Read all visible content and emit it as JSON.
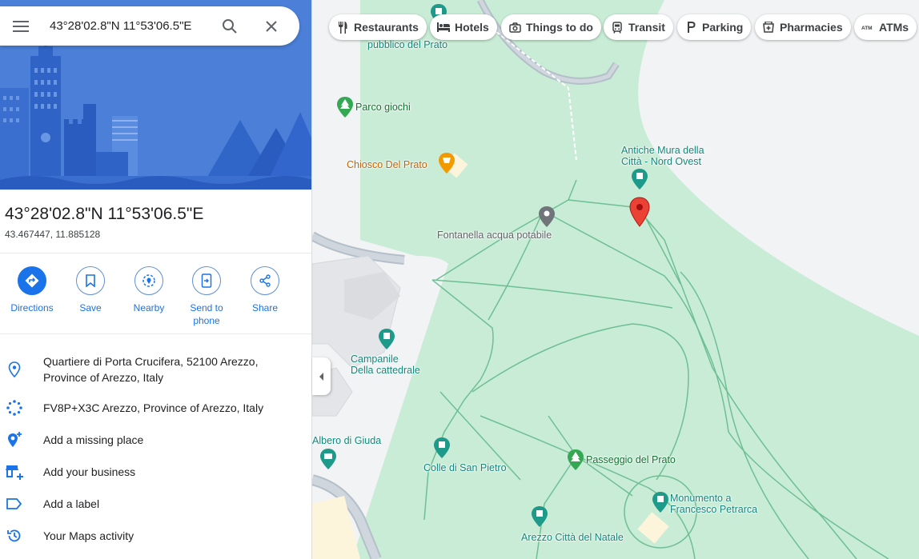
{
  "search": {
    "value": "43°28'02.8\"N 11°53'06.5\"E"
  },
  "place": {
    "title": "43°28'02.8\"N 11°53'06.5\"E",
    "decimal": "43.467447, 11.885128"
  },
  "actions": [
    {
      "label": "Directions",
      "icon": "directions-icon"
    },
    {
      "label": "Save",
      "icon": "bookmark-icon"
    },
    {
      "label": "Nearby",
      "icon": "nearby-icon"
    },
    {
      "label": "Send to phone",
      "icon": "send-to-phone-icon"
    },
    {
      "label": "Share",
      "icon": "share-icon"
    }
  ],
  "info": [
    {
      "text": "Quartiere di Porta Crucifera, 52100 Arezzo, Province of Arezzo, Italy",
      "icon": "location-pin-icon"
    },
    {
      "text": "FV8P+X3C Arezzo, Province of Arezzo, Italy",
      "icon": "plus-code-icon"
    },
    {
      "text": "Add a missing place",
      "icon": "add-location-icon"
    },
    {
      "text": "Add your business",
      "icon": "add-business-icon"
    },
    {
      "text": "Add a label",
      "icon": "label-icon"
    },
    {
      "text": "Your Maps activity",
      "icon": "history-icon"
    }
  ],
  "chips": [
    {
      "label": "Restaurants",
      "icon": "restaurant-icon"
    },
    {
      "label": "Hotels",
      "icon": "hotel-icon"
    },
    {
      "label": "Things to do",
      "icon": "camera-icon"
    },
    {
      "label": "Transit",
      "icon": "transit-icon"
    },
    {
      "label": "Parking",
      "icon": "parking-icon"
    },
    {
      "label": "Pharmacies",
      "icon": "pharmacy-icon"
    },
    {
      "label": "ATMs",
      "icon": "atm-icon"
    }
  ],
  "map_labels": {
    "parco_pubblico": "pubblico del Prato",
    "parco_giochi": "Parco giochi",
    "chiosco": "Chiosco Del Prato",
    "antiche_mura": "Antiche Mura della\nCittà - Nord Ovest",
    "fontanella": "Fontanella acqua potabile",
    "campanile": "Campanile\nDella cattedrale",
    "albero": "Albero di Giuda",
    "colle": "Colle di San Pietro",
    "passeggio": "Passeggio del Prato",
    "monumento": "Monumento a\nFrancesco Petrarca",
    "arezzo_natale": "Arezzo Città del Natale"
  },
  "colors": {
    "park": "#c8ecd5",
    "park_path": "#5fb88a",
    "road": "#b4bfc9",
    "accent": "#1a73e8",
    "pin_red": "#ea4335"
  }
}
